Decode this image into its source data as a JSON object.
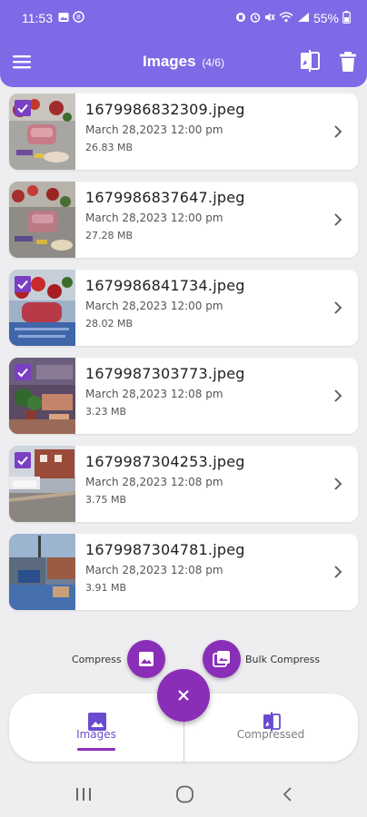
{
  "status_bar": {
    "time": "11:53",
    "battery_pct": "55%"
  },
  "app_bar": {
    "title": "Images",
    "count": "(4/6)",
    "icons": [
      "menu-icon",
      "compare-icon",
      "delete-icon"
    ]
  },
  "colors": {
    "app_bar": "#7e6ae6",
    "accent": "#8a2eb8",
    "checkbox": "#7b3fc4",
    "tab_active": "#6a4bd0"
  },
  "images": [
    {
      "name": "1679986832309.jpeg",
      "date": "March 28,2023 12:00 pm",
      "size": "26.83 MB",
      "selected": true
    },
    {
      "name": "1679986837647.jpeg",
      "date": "March 28,2023 12:00 pm",
      "size": "27.28 MB",
      "selected": false
    },
    {
      "name": "1679986841734.jpeg",
      "date": "March 28,2023 12:00 pm",
      "size": "28.02 MB",
      "selected": true
    },
    {
      "name": "1679987303773.jpeg",
      "date": "March 28,2023 12:08 pm",
      "size": "3.23 MB",
      "selected": true
    },
    {
      "name": "1679987304253.jpeg",
      "date": "March 28,2023 12:08 pm",
      "size": "3.75 MB",
      "selected": true
    },
    {
      "name": "1679987304781.jpeg",
      "date": "March 28,2023 12:08 pm",
      "size": "3.91 MB",
      "selected": false
    }
  ],
  "actions": {
    "compress_label": "Compress",
    "bulk_compress_label": "Bulk Compress"
  },
  "tabs": [
    {
      "label": "Images",
      "icon": "image-icon",
      "active": true
    },
    {
      "label": "Compressed",
      "icon": "compare-icon",
      "active": false
    }
  ]
}
